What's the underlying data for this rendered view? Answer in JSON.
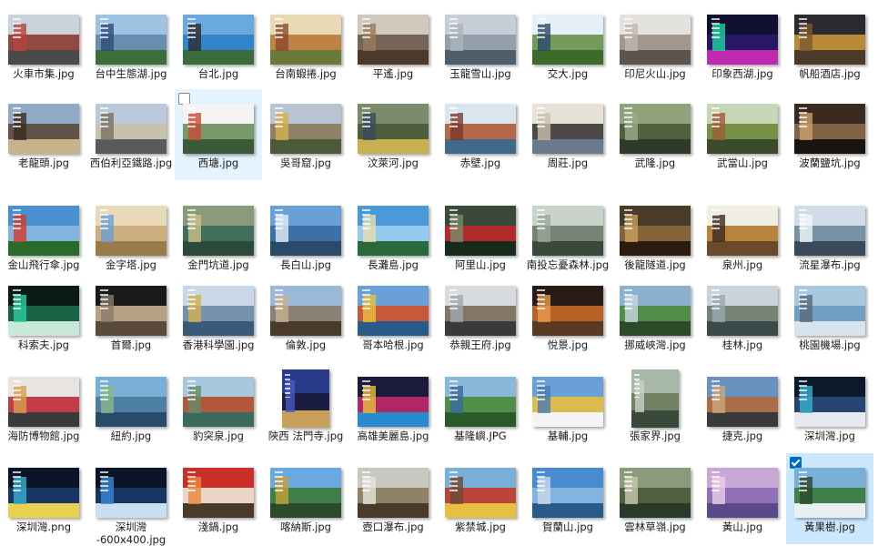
{
  "accent": "#0067c0",
  "files": [
    {
      "name": "火車市集.jpg",
      "colors": [
        "#c9d3d9",
        "#8b3a2f",
        "#4a4a4a",
        "#b5433a"
      ]
    },
    {
      "name": "台中生態湖.jpg",
      "colors": [
        "#9fc2e3",
        "#5f8aa8",
        "#3c6e3a",
        "#2e4a7a"
      ]
    },
    {
      "name": "台北.jpg",
      "colors": [
        "#6aa8e0",
        "#2f7fc7",
        "#3a6b3a",
        "#2c2c2c"
      ]
    },
    {
      "name": "台南蝦捲.jpg",
      "colors": [
        "#e8d9b5",
        "#b9783b",
        "#6b7a3a",
        "#8a4b2a"
      ]
    },
    {
      "name": "平遙.jpg",
      "colors": [
        "#cfc8bd",
        "#6b5a4a",
        "#4a3a2e",
        "#9b7a5a"
      ]
    },
    {
      "name": "玉龍雪山.jpg",
      "colors": [
        "#c7ced6",
        "#8e9aa6",
        "#4f5e6b",
        "#aab4bf"
      ]
    },
    {
      "name": "交大.jpg",
      "colors": [
        "#e6f0f8",
        "#6a8f4a",
        "#3a6b2a",
        "#2c4a6a"
      ]
    },
    {
      "name": "印尼火山.jpg",
      "colors": [
        "#e4e2df",
        "#9a8f85",
        "#5e544c",
        "#c0b6ab"
      ]
    },
    {
      "name": "印象西湖.jpg",
      "colors": [
        "#101030",
        "#2a1a6a",
        "#c02ab0",
        "#1fd4a0"
      ]
    },
    {
      "name": "帆船酒店.jpg",
      "colors": [
        "#2a2a30",
        "#c9933a",
        "#4a3a2a",
        "#7a5a30"
      ]
    },
    {
      "name": "老龍頭.jpg",
      "colors": [
        "#8fa9c6",
        "#5b4a3a",
        "#c7b28a",
        "#3a2a20"
      ]
    },
    {
      "name": "西伯利亞鐵路.jpg",
      "colors": [
        "#b8c9da",
        "#c9c0a8",
        "#5a5a5a",
        "#7a7060"
      ]
    },
    {
      "name": "西塘.jpg",
      "colors": [
        "#f4f4f4",
        "#6a8f5a",
        "#3a5a3a",
        "#c94a3a"
      ]
    },
    {
      "name": "吳哥窟.jpg",
      "colors": [
        "#b8c3d3",
        "#8a7a5a",
        "#4a5a3a",
        "#d4b050"
      ]
    },
    {
      "name": "汶萊河.jpg",
      "colors": [
        "#7a8a6a",
        "#4a5a3a",
        "#c9b050",
        "#3a4a5a"
      ]
    },
    {
      "name": "赤壁.jpg",
      "colors": [
        "#d9e5ef",
        "#b05a3a",
        "#3f6a8a",
        "#7a3a2a"
      ]
    },
    {
      "name": "周莊.jpg",
      "colors": [
        "#e8e2d6",
        "#3a3a3a",
        "#6a7a8a",
        "#c9bfae"
      ]
    },
    {
      "name": "武隆.jpg",
      "colors": [
        "#8fa37a",
        "#4a5a3a",
        "#2e3a2a",
        "#9aab8a"
      ]
    },
    {
      "name": "武當山.jpg",
      "colors": [
        "#c7d6b8",
        "#6a8a3a",
        "#3a4a2a",
        "#a05a3a"
      ]
    },
    {
      "name": "波蘭鹽坑.jpg",
      "colors": [
        "#3a2a20",
        "#8a6a4a",
        "#1a1410",
        "#c9a06a"
      ]
    },
    {
      "name": "金山飛行傘.jpg",
      "colors": [
        "#4a90d0",
        "#8ab8e0",
        "#2a6a2a",
        "#d43a2a"
      ]
    },
    {
      "name": "金字塔.jpg",
      "colors": [
        "#e8d9b8",
        "#c9a87a",
        "#9a7a4a",
        "#6aa0d0"
      ]
    },
    {
      "name": "金門坑道.jpg",
      "colors": [
        "#8a9a7a",
        "#3a6a5a",
        "#2a4a3a",
        "#c9c08a"
      ]
    },
    {
      "name": "長白山.jpg",
      "colors": [
        "#6aa0d8",
        "#3a6aa0",
        "#2a4a6a",
        "#e6eef6"
      ]
    },
    {
      "name": "長灘島.jpg",
      "colors": [
        "#4a9ad8",
        "#9ad0f0",
        "#2a6a3a",
        "#e8dcb0"
      ]
    },
    {
      "name": "阿里山.jpg",
      "colors": [
        "#3a4a3a",
        "#c0282a",
        "#1a2a1a",
        "#7a8a6a"
      ]
    },
    {
      "name": "南投忘憂森林.jpg",
      "colors": [
        "#c9d3cc",
        "#6a7a6a",
        "#3a4a3a",
        "#9aa89a"
      ]
    },
    {
      "name": "後龍隧道.jpg",
      "colors": [
        "#4a3a2a",
        "#8a6a3a",
        "#2a1a10",
        "#c9a05a"
      ]
    },
    {
      "name": "泉州.jpg",
      "colors": [
        "#f2eee6",
        "#b0782a",
        "#6a4a2a",
        "#3a2a20"
      ]
    },
    {
      "name": "流星瀑布.jpg",
      "colors": [
        "#d0dde8",
        "#6a8aa0",
        "#3a4a5a",
        "#f4f6f8"
      ]
    },
    {
      "name": "科索夫.jpg",
      "colors": [
        "#0a1a14",
        "#1a6a4a",
        "#c9e8d8",
        "#2ad0a0"
      ]
    },
    {
      "name": "首爾.jpg",
      "colors": [
        "#1a1a1a",
        "#c9b090",
        "#5a4a3a",
        "#8a7a6a"
      ]
    },
    {
      "name": "香港科學園.jpg",
      "colors": [
        "#c9d8e6",
        "#6a8aa6",
        "#3a5a7a",
        "#d4b050"
      ]
    },
    {
      "name": "倫敦.jpg",
      "colors": [
        "#9ab8d8",
        "#8a7a6a",
        "#4a3a2a",
        "#c9b090"
      ]
    },
    {
      "name": "哥本哈根.jpg",
      "colors": [
        "#6aa0d8",
        "#d0502a",
        "#2a5a8a",
        "#e8c040"
      ]
    },
    {
      "name": "恭親王府.jpg",
      "colors": [
        "#d8dce0",
        "#7a6a5a",
        "#3a3a3a",
        "#a0a8b0"
      ]
    },
    {
      "name": "悅景.jpg",
      "colors": [
        "#2a1a14",
        "#c96a2a",
        "#5a3a20",
        "#e89a4a"
      ]
    },
    {
      "name": "挪威峽灣.jpg",
      "colors": [
        "#8ab0d0",
        "#4a8a3a",
        "#2a4a2a",
        "#c9d8e6"
      ]
    },
    {
      "name": "桂林.jpg",
      "colors": [
        "#c9d3d8",
        "#6a7a6a",
        "#3a4a4a",
        "#9aaab0"
      ]
    },
    {
      "name": "桃園機場.jpg",
      "colors": [
        "#a8c8e0",
        "#6a9ac0",
        "#d8e4ec",
        "#5a6a7a"
      ]
    },
    {
      "name": "海防博物館.jpg",
      "colors": [
        "#e8e4e0",
        "#c0283a",
        "#3a3a3a",
        "#d8a050"
      ]
    },
    {
      "name": "紐約.jpg",
      "colors": [
        "#7ab0d8",
        "#4a7aa0",
        "#2a4a6a",
        "#8ab88a"
      ]
    },
    {
      "name": "豹突泉.jpg",
      "colors": [
        "#a8c8e0",
        "#b04a2a",
        "#3a6a5a",
        "#6a8a6a"
      ]
    },
    {
      "name": "陝西 法門寺.jpg",
      "colors": [
        "#2a3a8a",
        "#1a1a3a",
        "#c9a05a",
        "#4a5ac0"
      ],
      "tall": true
    },
    {
      "name": "高雄美麗島.jpg",
      "colors": [
        "#1a1a3a",
        "#c02a6a",
        "#2a8ad0",
        "#e8c03a"
      ]
    },
    {
      "name": "基隆嶼.JPG",
      "colors": [
        "#8ab8d8",
        "#4a8a3a",
        "#2a5a2a",
        "#3a6aa0"
      ]
    },
    {
      "name": "基輔.jpg",
      "colors": [
        "#6aa0d8",
        "#e8c040",
        "#f4f4f4",
        "#4a7ab0"
      ]
    },
    {
      "name": "張家界.jpg",
      "colors": [
        "#a8b8a8",
        "#6a7a5a",
        "#3a4a3a",
        "#c9d0c8"
      ],
      "tall": true
    },
    {
      "name": "捷克.jpg",
      "colors": [
        "#6a90c0",
        "#b06a3a",
        "#3a3a3a",
        "#c9a87a"
      ]
    },
    {
      "name": "深圳灣.jpg",
      "colors": [
        "#0a1a2a",
        "#2a4a7a",
        "#e8e8f0",
        "#3ab0d0"
      ]
    },
    {
      "name": "深圳灣.png",
      "colors": [
        "#0a1426",
        "#1a3a6a",
        "#e8d050",
        "#3ab0d0"
      ]
    },
    {
      "name": "深圳灣\n-600x400.jpg",
      "colors": [
        "#0a1426",
        "#1a3a6a",
        "#c9e0f0",
        "#3a8ad0"
      ]
    },
    {
      "name": "淺鍋.jpg",
      "colors": [
        "#c9302a",
        "#f0e8d8",
        "#4a3a2a",
        "#e88a3a"
      ]
    },
    {
      "name": "喀納斯.jpg",
      "colors": [
        "#6aa8e0",
        "#3a7a3a",
        "#2a4a2a",
        "#c9a03a"
      ]
    },
    {
      "name": "壺口瀑布.jpg",
      "colors": [
        "#c9c8c0",
        "#8a7a5a",
        "#4a3a2a",
        "#e8e4dc"
      ]
    },
    {
      "name": "紫禁城.jpg",
      "colors": [
        "#7ab0d8",
        "#c03a2a",
        "#e8c040",
        "#6a4a3a"
      ]
    },
    {
      "name": "賀蘭山.jpg",
      "colors": [
        "#4a8ad0",
        "#8ab8e0",
        "#2a5a8a",
        "#c9d8e6"
      ]
    },
    {
      "name": "雲林草嶺.jpg",
      "colors": [
        "#8a9a7a",
        "#4a5a3a",
        "#2a3a2a",
        "#c9c8b0"
      ]
    },
    {
      "name": "黃山.jpg",
      "colors": [
        "#c9a8d8",
        "#8a6ab0",
        "#5a4a8a",
        "#e8d0e8"
      ]
    },
    {
      "name": "黃果樹.jpg",
      "colors": [
        "#7ab0d8",
        "#3a7a3a",
        "#e8f0f4",
        "#2a4a2a"
      ]
    }
  ]
}
